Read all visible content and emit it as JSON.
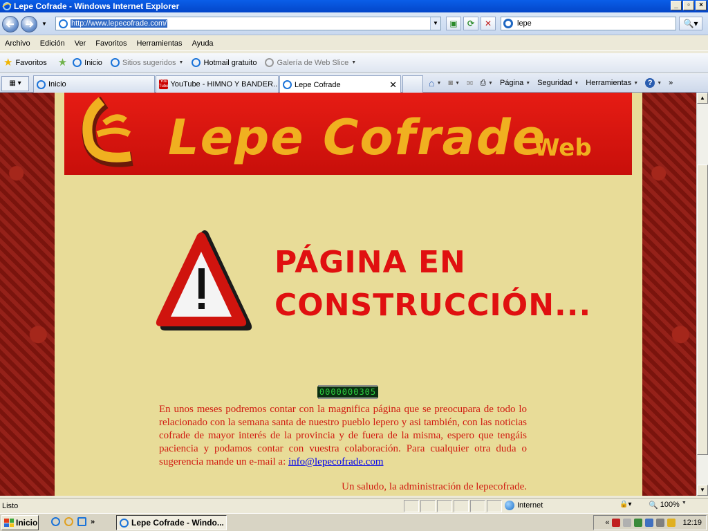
{
  "window": {
    "title": "Lepe Cofrade - Windows Internet Explorer"
  },
  "address": {
    "url": "http://www.lepecofrade.com/"
  },
  "search": {
    "value": "lepe"
  },
  "menu": [
    "Archivo",
    "Edición",
    "Ver",
    "Favoritos",
    "Herramientas",
    "Ayuda"
  ],
  "favorites": {
    "label": "Favoritos",
    "items": [
      {
        "label": "Inicio"
      },
      {
        "label": "Sitios sugeridos"
      },
      {
        "label": "Hotmail gratuito"
      },
      {
        "label": "Galería de Web Slice"
      }
    ]
  },
  "tabs": [
    {
      "label": "Inicio"
    },
    {
      "label": "YouTube - HIMNO Y BANDER..."
    },
    {
      "label": "Lepe Cofrade"
    }
  ],
  "commandbar": {
    "page": "Página",
    "security": "Seguridad",
    "tools": "Herramientas"
  },
  "site": {
    "name": "Lepe Cofrade",
    "web": "Web",
    "heading_1": "PÁGINA EN",
    "heading_2": "CONSTRUCCIÓN...",
    "counter": "0000000305",
    "message": "En unos meses podremos contar con la magnifica página que se preocupara de todo lo relacionado con la semana santa de nuestro pueblo lepero y asi también, con las noticias cofrade de mayor interés de la provincia y de fuera de la misma, espero que tengáis paciencia y podamos contar con vuestra colaboración. Para cualquier otra duda o sugerencia mande un e-mail a:",
    "email": "info@lepecofrade.com",
    "signature": "Un saludo, la administración de lepecofrade."
  },
  "status": {
    "text": "Listo",
    "zone": "Internet",
    "zoom": "100%"
  },
  "taskbar": {
    "start": "Inicio",
    "task": "Lepe Cofrade - Windo...",
    "clock": "12:19"
  },
  "colors": {
    "title_bar": "#0a5ee8",
    "banner": "#e61c14",
    "brand_text": "#f0b020",
    "heading": "#e01010",
    "page_bg": "#e8dc98"
  }
}
